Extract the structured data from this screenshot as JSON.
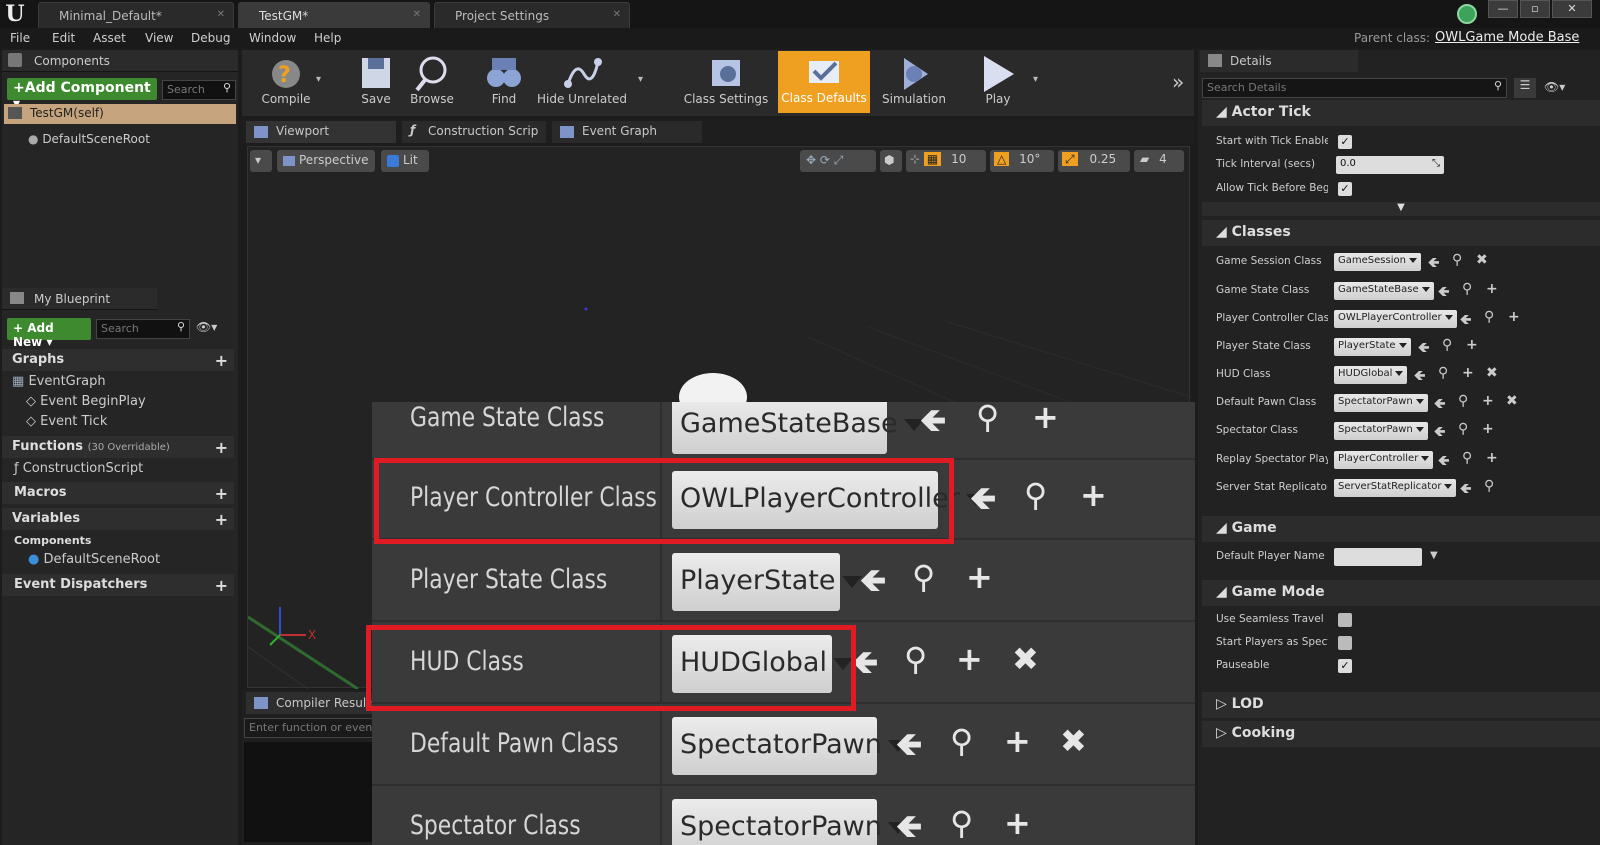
{
  "titlebar": {
    "tabs": [
      "Minimal_Default*",
      "TestGM*",
      "Project Settings"
    ],
    "win_buttons": [
      "—",
      "▫",
      "✕"
    ]
  },
  "menu": {
    "items": [
      "File",
      "Edit",
      "Asset",
      "View",
      "Debug",
      "Window",
      "Help"
    ],
    "parent_class_label": "Parent class:",
    "parent_class_value": "OWLGame Mode Base"
  },
  "components": {
    "title": "Components",
    "add_button": "+Add Component",
    "search_placeholder": "Search",
    "self_item": "TestGM(self)",
    "root_item": "DefaultSceneRoot"
  },
  "my_blueprint": {
    "title": "My Blueprint",
    "add_new": "Add New",
    "search_placeholder": "Search",
    "graphs": "Graphs",
    "event_graph": "EventGraph",
    "events": [
      "Event BeginPlay",
      "Event Tick"
    ],
    "functions": "Functions",
    "functions_count": "(30 Overridable)",
    "construction_script": "ConstructionScript",
    "macros": "Macros",
    "variables": "Variables",
    "components_cat": "Components",
    "default_scene_root": "DefaultSceneRoot",
    "event_dispatchers": "Event Dispatchers"
  },
  "toolbar": {
    "buttons": [
      "Compile",
      "Save",
      "Browse",
      "Find",
      "Hide Unrelated",
      "Class Settings",
      "Class Defaults",
      "Simulation",
      "Play"
    ]
  },
  "editor_tabs": [
    "Viewport",
    "Construction Scrip",
    "Event Graph"
  ],
  "viewport": {
    "perspective": "Perspective",
    "lit": "Lit",
    "grid_snap": "10",
    "rot_snap": "10°",
    "scale_snap": "0.25",
    "cam_speed": "4"
  },
  "compiler": {
    "tab": "Compiler Results",
    "input_placeholder": "Enter function or event"
  },
  "zoom": {
    "rows": [
      {
        "label": "Game State Class",
        "value": "GameStateBase"
      },
      {
        "label": "Player Controller Class",
        "value": "OWLPlayerController"
      },
      {
        "label": "Player State Class",
        "value": "PlayerState"
      },
      {
        "label": "HUD Class",
        "value": "HUDGlobal"
      },
      {
        "label": "Default Pawn Class",
        "value": "SpectatorPawn"
      },
      {
        "label": "Spectator Class",
        "value": "SpectatorPawn"
      }
    ]
  },
  "details": {
    "title": "Details",
    "search_placeholder": "Search Details",
    "actor_tick": "Actor Tick",
    "tick_rows": [
      "Start with Tick Enabled",
      "Tick Interval (secs)",
      "Allow Tick Before Begin"
    ],
    "tick_interval": "0.0",
    "classes": "Classes",
    "class_rows": [
      {
        "label": "Game Session Class",
        "value": "GameSession"
      },
      {
        "label": "Game State Class",
        "value": "GameStateBase"
      },
      {
        "label": "Player Controller Class",
        "value": "OWLPlayerController"
      },
      {
        "label": "Player State Class",
        "value": "PlayerState"
      },
      {
        "label": "HUD Class",
        "value": "HUDGlobal"
      },
      {
        "label": "Default Pawn Class",
        "value": "SpectatorPawn"
      },
      {
        "label": "Spectator Class",
        "value": "SpectatorPawn"
      },
      {
        "label": "Replay Spectator Player",
        "value": "PlayerController"
      },
      {
        "label": "Server Stat Replicator Class",
        "value": "ServerStatReplicator"
      }
    ],
    "game": "Game",
    "default_player_name": "Default Player Name",
    "game_mode": "Game Mode",
    "game_mode_rows": [
      "Use Seamless Travel",
      "Start Players as Spectators",
      "Pauseable"
    ],
    "lod": "LOD",
    "cooking": "Cooking"
  },
  "colors": {
    "accent": "#f0a020",
    "highlight": "#e01b24",
    "green": "#3d8a2f"
  }
}
